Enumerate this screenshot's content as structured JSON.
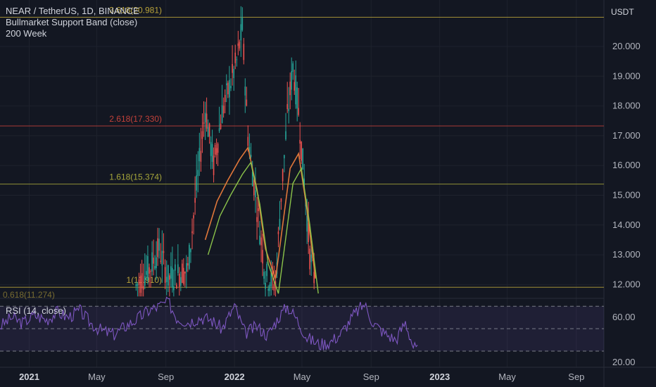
{
  "header": {
    "symbol_line": "NEAR / TetherUS, 1D, BINANCE",
    "indicators": [
      "Bullmarket Support Band (close)",
      "200 Week"
    ]
  },
  "price_axis": {
    "unit": "USDT",
    "ticks": [
      "20.000",
      "19.000",
      "18.000",
      "17.000",
      "16.000",
      "15.000",
      "14.000",
      "13.000",
      "12.000"
    ]
  },
  "rsi_panel": {
    "label": "RSI (14, close)",
    "ticks": [
      "60.00",
      "20.00"
    ],
    "bands": [
      70,
      50,
      30
    ]
  },
  "time_axis": {
    "labels": [
      {
        "text": "2021",
        "bold": true
      },
      {
        "text": "May",
        "bold": false
      },
      {
        "text": "Sep",
        "bold": false
      },
      {
        "text": "2022",
        "bold": true
      },
      {
        "text": "May",
        "bold": false
      },
      {
        "text": "Sep",
        "bold": false
      },
      {
        "text": "2023",
        "bold": true
      },
      {
        "text": "May",
        "bold": false
      },
      {
        "text": "Sep",
        "bold": false
      }
    ]
  },
  "fib_levels": [
    {
      "label": "3.618(20.981)",
      "value": 20.981,
      "color": "#b8a23a"
    },
    {
      "label": "2.618(17.330)",
      "value": 17.33,
      "color": "#c2413a"
    },
    {
      "label": "1.618(15.374)",
      "value": 15.374,
      "color": "#a5a53a"
    },
    {
      "label": "1(11.910)",
      "value": 11.91,
      "color": "#b8a23a"
    },
    {
      "label": "0.618(11.274)",
      "value": 11.274,
      "color": "#b8a23a"
    }
  ],
  "colors": {
    "background": "#131722",
    "grid": "#1e222d",
    "rsi_line": "#7e57c2",
    "rsi_band_fill": "#7e57c2",
    "candle_up": "#26a69a",
    "candle_down": "#ef5350",
    "ma_band_1": "#e0773a",
    "ma_band_2": "#8bc34a"
  },
  "chart_data": [
    {
      "type": "candlestick",
      "title": "NEAR / TetherUS, 1D, BINANCE",
      "ylim": [
        11.5,
        21.0
      ],
      "x_range": [
        "2020-11-10",
        "2023-10-20"
      ],
      "series": [
        {
          "name": "Price",
          "points": [
            [
              "2021-07-10",
              11.95
            ],
            [
              "2021-08-05",
              12.6
            ],
            [
              "2021-08-20",
              13.2
            ],
            [
              "2021-09-05",
              12.2
            ],
            [
              "2021-10-10",
              12.5
            ],
            [
              "2021-11-10",
              17.9
            ],
            [
              "2021-11-25",
              16.0
            ],
            [
              "2021-12-10",
              17.8
            ],
            [
              "2022-01-05",
              19.5
            ],
            [
              "2022-01-15",
              20.6
            ],
            [
              "2022-01-25",
              17.0
            ],
            [
              "2022-02-10",
              14.6
            ],
            [
              "2022-02-25",
              12.3
            ],
            [
              "2022-03-15",
              12.0
            ],
            [
              "2022-03-25",
              15.0
            ],
            [
              "2022-04-05",
              17.6
            ],
            [
              "2022-04-15",
              19.3
            ],
            [
              "2022-04-25",
              17.8
            ],
            [
              "2022-05-05",
              15.5
            ],
            [
              "2022-05-15",
              13.0
            ],
            [
              "2022-05-25",
              12.0
            ]
          ]
        },
        {
          "name": "Bullmarket Support Band (close)",
          "points": [
            [
              "2021-11-10",
              13.5
            ],
            [
              "2021-12-01",
              14.8
            ],
            [
              "2021-12-20",
              15.5
            ],
            [
              "2022-01-10",
              16.2
            ],
            [
              "2022-01-25",
              16.6
            ],
            [
              "2022-02-10",
              15.2
            ],
            [
              "2022-02-25",
              13.2
            ],
            [
              "2022-03-15",
              12.2
            ],
            [
              "2022-03-25",
              13.6
            ],
            [
              "2022-04-10",
              15.9
            ],
            [
              "2022-04-25",
              16.4
            ],
            [
              "2022-05-10",
              14.5
            ],
            [
              "2022-05-25",
              12.2
            ]
          ]
        }
      ]
    },
    {
      "type": "line",
      "title": "RSI (14, close)",
      "ylim": [
        20,
        80
      ],
      "series": [
        {
          "name": "RSI (14, close)",
          "points": [
            [
              "2020-11-10",
              52
            ],
            [
              "2020-12-01",
              60
            ],
            [
              "2020-12-20",
              55
            ],
            [
              "2021-01-10",
              62
            ],
            [
              "2021-02-01",
              58
            ],
            [
              "2021-02-20",
              65
            ],
            [
              "2021-03-10",
              60
            ],
            [
              "2021-04-01",
              66
            ],
            [
              "2021-04-20",
              55
            ],
            [
              "2021-05-10",
              48
            ],
            [
              "2021-06-01",
              45
            ],
            [
              "2021-06-20",
              52
            ],
            [
              "2021-07-10",
              58
            ],
            [
              "2021-08-01",
              66
            ],
            [
              "2021-08-20",
              70
            ],
            [
              "2021-09-05",
              74
            ],
            [
              "2021-09-20",
              60
            ],
            [
              "2021-10-10",
              56
            ],
            [
              "2021-11-01",
              60
            ],
            [
              "2021-11-20",
              58
            ],
            [
              "2021-12-10",
              50
            ],
            [
              "2022-01-01",
              70
            ],
            [
              "2022-01-20",
              46
            ],
            [
              "2022-02-10",
              52
            ],
            [
              "2022-03-01",
              44
            ],
            [
              "2022-03-20",
              60
            ],
            [
              "2022-04-05",
              70
            ],
            [
              "2022-04-20",
              60
            ],
            [
              "2022-05-10",
              42
            ],
            [
              "2022-06-01",
              36
            ],
            [
              "2022-06-20",
              38
            ],
            [
              "2022-07-10",
              46
            ],
            [
              "2022-08-01",
              62
            ],
            [
              "2022-08-20",
              72
            ],
            [
              "2022-09-05",
              55
            ],
            [
              "2022-09-25",
              46
            ],
            [
              "2022-10-15",
              40
            ],
            [
              "2022-11-01",
              56
            ],
            [
              "2022-11-15",
              34
            ],
            [
              "2022-11-25",
              30
            ]
          ]
        }
      ]
    }
  ]
}
